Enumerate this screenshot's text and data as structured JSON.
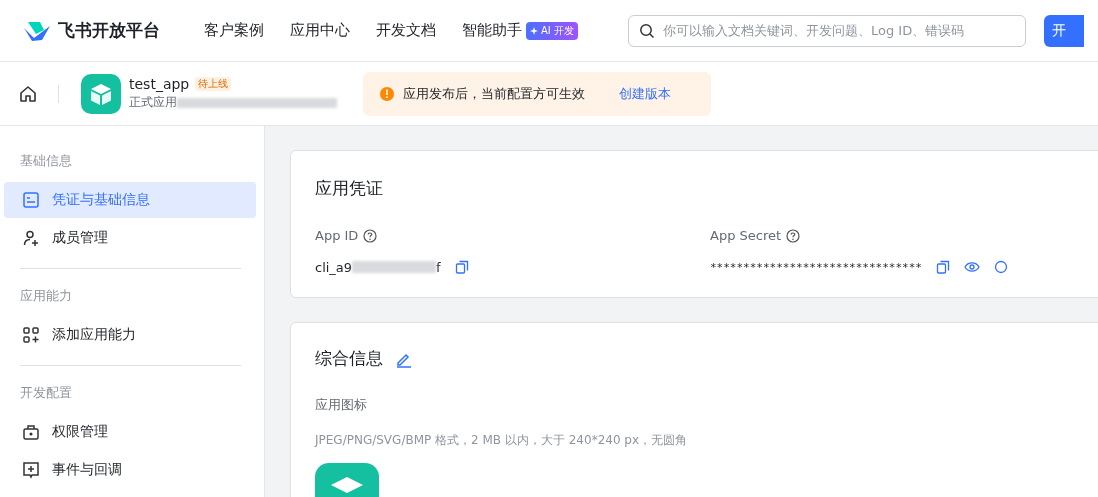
{
  "header": {
    "brand": "飞书开放平台",
    "nav": [
      {
        "label": "客户案例"
      },
      {
        "label": "应用中心"
      },
      {
        "label": "开发文档"
      },
      {
        "label": "智能助手",
        "badge": "AI 开发"
      }
    ],
    "search": {
      "placeholder": "你可以输入文档关键词、开发问题、Log ID、错误码"
    },
    "cta": "开"
  },
  "app_bar": {
    "name": "test_app",
    "status": "待上线",
    "subtitle": "正式应用",
    "notice": "应用发布后，当前配置方可生效",
    "notice_link": "创建版本"
  },
  "sidebar": {
    "groups": [
      {
        "title": "基础信息",
        "items": [
          {
            "label": "凭证与基础信息",
            "kind": "card",
            "selected": true
          },
          {
            "label": "成员管理",
            "kind": "user",
            "selected": false
          }
        ]
      },
      {
        "title": "应用能力",
        "items": [
          {
            "label": "添加应用能力",
            "kind": "grid",
            "selected": false
          }
        ]
      },
      {
        "title": "开发配置",
        "items": [
          {
            "label": "权限管理",
            "kind": "lock",
            "selected": false
          },
          {
            "label": "事件与回调",
            "kind": "plus",
            "selected": false
          }
        ]
      }
    ]
  },
  "credentials": {
    "title": "应用凭证",
    "app_id": {
      "label": "App ID",
      "value_start": "cli_a9",
      "value_end": "f"
    },
    "app_secret": {
      "label": "App Secret",
      "value": "********************************"
    }
  },
  "general": {
    "title": "综合信息",
    "icon_label": "应用图标",
    "icon_hint": "JPEG/PNG/SVG/BMP 格式，2 MB 以内，大于 240*240 px，无圆角"
  }
}
